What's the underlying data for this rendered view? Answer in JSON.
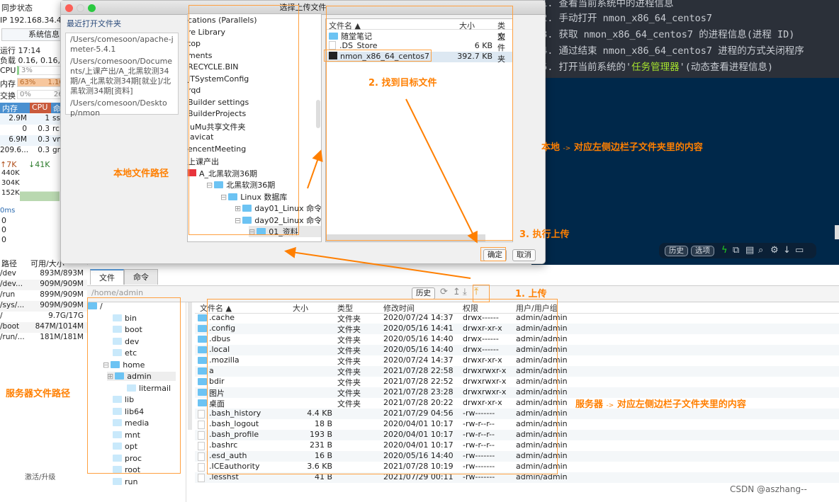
{
  "sidebar": {
    "sync_status": "同步状态",
    "ip": "IP 192.168.34.47",
    "sysinfo_button": "系统信息",
    "uptime": "运行 17:14",
    "load": "负载 0.16, 0.16, 0",
    "cpu_label": "CPU",
    "cpu_value": "3%",
    "cpu_percent": 3,
    "mem_label": "内存",
    "mem_value": "63%",
    "mem_extra": "1.1G",
    "mem_percent": 63,
    "swap_label": "交换",
    "swap_value": "0%",
    "swap_extra": "26",
    "proc_headers": [
      "内存",
      "CPU",
      "命"
    ],
    "processes": [
      {
        "mem": "2.9M",
        "cpu": "1",
        "cmd": "ss"
      },
      {
        "mem": "0",
        "cpu": "0.3",
        "cmd": "rc"
      },
      {
        "mem": "6.9M",
        "cpu": "0.3",
        "cmd": "vm"
      },
      {
        "mem": "209.6...",
        "cpu": "0.3",
        "cmd": "gn"
      }
    ],
    "net_up": "7K",
    "net_down": "41K",
    "net_ticks": [
      "440K",
      "304K",
      "152K"
    ],
    "latency": "0ms",
    "latency_vals": [
      "0",
      "0",
      "0"
    ],
    "disk_headers": [
      "路径",
      "可用/大小"
    ],
    "disks": [
      {
        "path": "/dev",
        "size": "893M/893M"
      },
      {
        "path": "/dev...",
        "size": "909M/909M"
      },
      {
        "path": "/run",
        "size": "899M/909M"
      },
      {
        "path": "/sys/...",
        "size": "909M/909M"
      },
      {
        "path": "/",
        "size": "9.7G/17G"
      },
      {
        "path": "/boot",
        "size": "847M/1014M"
      },
      {
        "path": "/run/...",
        "size": "181M/181M"
      }
    ],
    "activate": "激活/升级"
  },
  "terminal": {
    "lines": [
      "01. 查看当前系统中的进程信息",
      "02. 手动打开 nmon_x86_64_centos7",
      "03. 获取 nmon_x86_64_centos7 的进程信息(进程 ID)",
      "04. 通过结束 nmon_x86_64_centos7 进程的方式关闭程序"
    ],
    "line5_pre": "05. 打开当前系统的'",
    "line5_hl": "任务管理器",
    "line5_post": "'(动态查看进程信息)",
    "toolbar": {
      "history": "历史",
      "options": "选项"
    }
  },
  "dialog": {
    "title": "选择上传文件",
    "recent_title": "最近打开文件夹",
    "recent": [
      "/Users/comesoon/apache-jmeter-5.4.1",
      "/Users/comesoon/Documents/上课产出/A_北黑软测34期/A_北黑软测34期[就业]/北黑软测34期[资料]",
      "/Users/comesoon/Desktop/nmon"
    ],
    "tree": [
      "cations (Parallels)",
      "re Library",
      "top",
      "ments",
      "RECYCLE.BIN",
      "JTSystemConfig",
      "rqd",
      "Builder settings",
      "BuilderProjects",
      "luMu共享文件夹",
      "lavicat",
      "encentMeeting",
      "上课产出",
      "A_北黑软测36期",
      "北黑软测36期",
      "Linux 数据库",
      "day01_Linux 命令01",
      "day02_Linux 命令02",
      "01_资料"
    ],
    "file_headers": [
      "文件名",
      "大小",
      "类型"
    ],
    "files": [
      {
        "name": "随堂笔记",
        "size": "",
        "type": "文件夹",
        "icon": "folder"
      },
      {
        "name": ".DS_Store",
        "size": "6 KB",
        "type": "",
        "icon": "file"
      },
      {
        "name": "nmon_x86_64_centos7",
        "size": "392.7 KB",
        "type": "",
        "icon": "terminal-exec"
      }
    ],
    "ok": "确定",
    "cancel": "取消"
  },
  "server": {
    "tabs": [
      "文件",
      "命令"
    ],
    "path": "/home/admin",
    "history": "历史",
    "tree": [
      "/",
      "bin",
      "boot",
      "dev",
      "etc",
      "home",
      "admin",
      "litermail",
      "lib",
      "lib64",
      "media",
      "mnt",
      "opt",
      "proc",
      "root",
      "run"
    ],
    "headers": [
      "文件名",
      "大小",
      "类型",
      "修改时间",
      "权限",
      "用户/用户组"
    ],
    "files": [
      {
        "name": ".cache",
        "size": "",
        "type": "文件夹",
        "mtime": "2020/07/24 14:37",
        "perm": "drwx------",
        "owner": "admin/admin"
      },
      {
        "name": ".config",
        "size": "",
        "type": "文件夹",
        "mtime": "2020/05/16 14:41",
        "perm": "drwxr-xr-x",
        "owner": "admin/admin"
      },
      {
        "name": ".dbus",
        "size": "",
        "type": "文件夹",
        "mtime": "2020/05/16 14:40",
        "perm": "drwx------",
        "owner": "admin/admin"
      },
      {
        "name": ".local",
        "size": "",
        "type": "文件夹",
        "mtime": "2020/05/16 14:40",
        "perm": "drwx------",
        "owner": "admin/admin"
      },
      {
        "name": ".mozilla",
        "size": "",
        "type": "文件夹",
        "mtime": "2020/07/24 14:37",
        "perm": "drwxr-xr-x",
        "owner": "admin/admin"
      },
      {
        "name": "a",
        "size": "",
        "type": "文件夹",
        "mtime": "2021/07/28 22:58",
        "perm": "drwxrwxr-x",
        "owner": "admin/admin"
      },
      {
        "name": "bdir",
        "size": "",
        "type": "文件夹",
        "mtime": "2021/07/28 22:52",
        "perm": "drwxrwxr-x",
        "owner": "admin/admin"
      },
      {
        "name": "图片",
        "size": "",
        "type": "文件夹",
        "mtime": "2021/07/28 23:28",
        "perm": "drwxrwxr-x",
        "owner": "admin/admin"
      },
      {
        "name": "桌面",
        "size": "",
        "type": "文件夹",
        "mtime": "2021/07/28 20:22",
        "perm": "drwxr-xr-x",
        "owner": "admin/admin"
      },
      {
        "name": ".bash_history",
        "size": "4.4 KB",
        "type": "",
        "mtime": "2021/07/29 04:56",
        "perm": "-rw-------",
        "owner": "admin/admin"
      },
      {
        "name": ".bash_logout",
        "size": "18 B",
        "type": "",
        "mtime": "2020/04/01 10:17",
        "perm": "-rw-r--r--",
        "owner": "admin/admin"
      },
      {
        "name": ".bash_profile",
        "size": "193 B",
        "type": "",
        "mtime": "2020/04/01 10:17",
        "perm": "-rw-r--r--",
        "owner": "admin/admin"
      },
      {
        "name": ".bashrc",
        "size": "231 B",
        "type": "",
        "mtime": "2020/04/01 10:17",
        "perm": "-rw-r--r--",
        "owner": "admin/admin"
      },
      {
        "name": ".esd_auth",
        "size": "16 B",
        "type": "",
        "mtime": "2020/05/16 14:40",
        "perm": "-rw-------",
        "owner": "admin/admin"
      },
      {
        "name": ".ICEauthority",
        "size": "3.6 KB",
        "type": "",
        "mtime": "2021/07/28 10:19",
        "perm": "-rw-------",
        "owner": "admin/admin"
      },
      {
        "name": ".lesshst",
        "size": "41 B",
        "type": "",
        "mtime": "2021/07/29 00:11",
        "perm": "-rw-------",
        "owner": "admin/admin"
      }
    ]
  },
  "annotations": {
    "local_path": "本地文件路径",
    "find_file": "2. 找到目标文件",
    "local_desc_a": "本地",
    "local_desc_b": "对应左侧边栏子文件夹里的内容",
    "execute": "3. 执行上传",
    "upload": "1. 上传",
    "server_path": "服务器文件路径",
    "server_desc_a": "服务器",
    "server_desc_b": "对应左侧边栏子文件夹里的内容",
    "arrow": "->"
  },
  "footer": {
    "credit": "CSDN @aszhang--"
  },
  "colors": {
    "annotation": "#ff7f00",
    "terminal_bg": "#00284a",
    "highlight": "#a6e22e"
  }
}
